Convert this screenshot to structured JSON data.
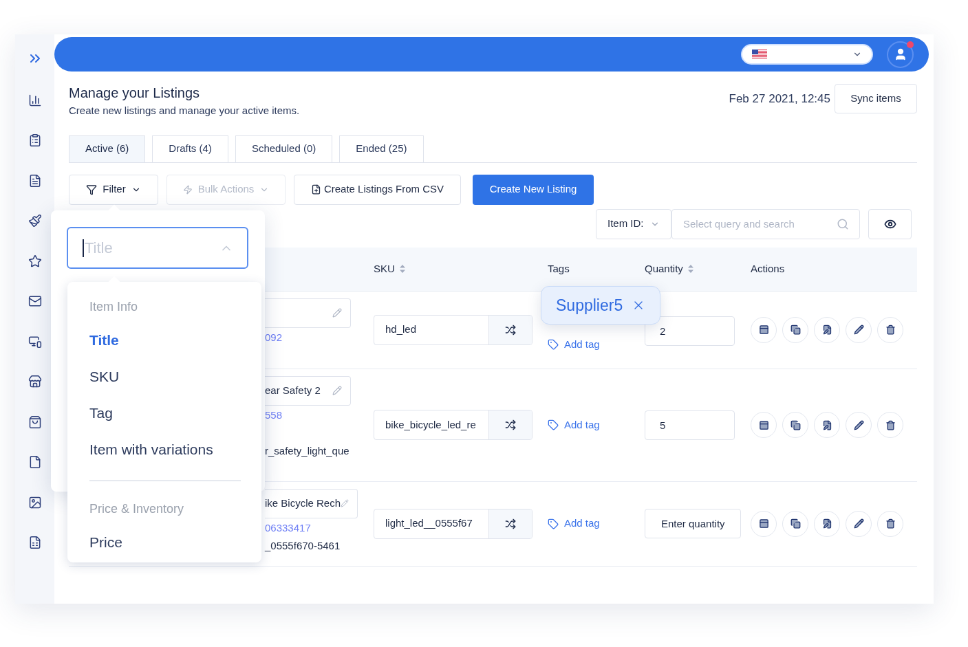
{
  "header": {
    "has_notification": true
  },
  "page": {
    "title": "Manage your Listings",
    "subtitle": "Create new listings and manage your active items.",
    "timestamp": "Feb 27 2021, 12:45",
    "sync_button": "Sync items"
  },
  "tabs": [
    {
      "label": "Active (6)",
      "selected": true
    },
    {
      "label": "Drafts (4)",
      "selected": false
    },
    {
      "label": "Scheduled (0)",
      "selected": false
    },
    {
      "label": "Ended (25)",
      "selected": false
    }
  ],
  "toolbar": {
    "filter": "Filter",
    "bulk_actions": {
      "label": "Bulk Actions",
      "disabled": true
    },
    "csv_button": "Create Listings From CSV",
    "create_button": "Create New Listing"
  },
  "search": {
    "field": "Item ID:",
    "placeholder": "Select query and search"
  },
  "table": {
    "columns": [
      {
        "label": "SKU",
        "sortable": true
      },
      {
        "label": "Tags",
        "sortable": false
      },
      {
        "label": "Quantity",
        "sortable": true
      },
      {
        "label": "Actions",
        "sortable": false
      }
    ],
    "rows": [
      {
        "item_id": "092",
        "sku": "hd_led",
        "add_tag": "Add tag",
        "quantity": {
          "value": "2"
        }
      },
      {
        "title": "ear Safety 2",
        "item_id": "558",
        "variant": "r_safety_light_que",
        "sku": "bike_bicycle_led_re",
        "add_tag": "Add tag",
        "quantity": {
          "value": "5"
        }
      },
      {
        "title": "ike Bicycle Rech",
        "item_id": "06333417",
        "variant": "_0555f670-5461",
        "sku": "light_led__0555f67",
        "add_tag": "Add tag",
        "quantity": {
          "placeholder": "Enter quantity"
        }
      }
    ]
  },
  "tag_tooltip": {
    "label": "Supplier5"
  },
  "filter_panel": {
    "field": {
      "placeholder": "Title"
    },
    "options": [
      {
        "kind": "group",
        "label": "Item Info"
      },
      {
        "kind": "option",
        "label": "Title",
        "selected": true
      },
      {
        "kind": "option",
        "label": "SKU",
        "selected": false
      },
      {
        "kind": "option",
        "label": "Tag",
        "selected": false
      },
      {
        "kind": "option",
        "label": "Item with variations",
        "selected": false
      },
      {
        "kind": "divider"
      },
      {
        "kind": "group",
        "label": "Price & Inventory"
      },
      {
        "kind": "option",
        "label": "Price",
        "selected": false
      }
    ]
  }
}
